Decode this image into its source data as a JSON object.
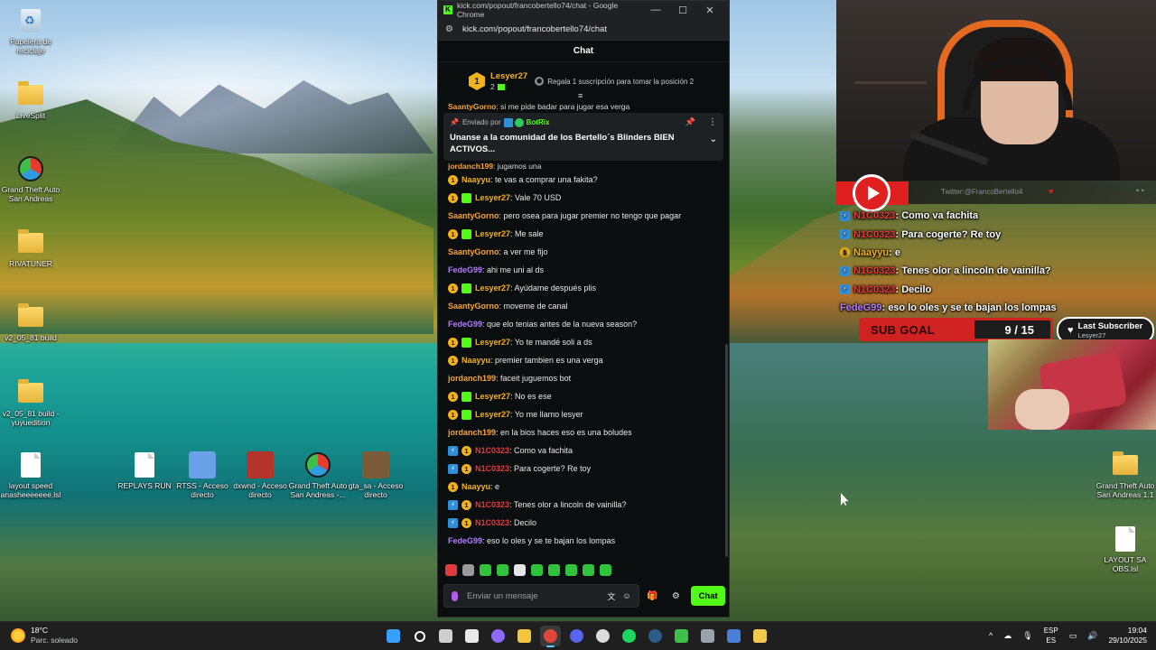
{
  "desktop": {
    "icons_left": [
      {
        "label": "Papelera de reciclaje",
        "kind": "bin"
      },
      {
        "label": "LiveSplit",
        "kind": "folder"
      },
      {
        "label": "Grand Theft Auto San Andreas",
        "kind": "gta"
      },
      {
        "label": "RIVATUNER",
        "kind": "folder"
      },
      {
        "label": "v2_05_81 build",
        "kind": "folder"
      },
      {
        "label": "v2_05_81 build - yuyuedition",
        "kind": "folder"
      },
      {
        "label": "layout speed anasheeeeeee.lsl",
        "kind": "file"
      }
    ],
    "icons_bottom": [
      {
        "label": "REPLAYS RUN",
        "kind": "file"
      },
      {
        "label": "RTSS - Acceso directo",
        "kind": "shortcut"
      },
      {
        "label": "dxwnd - Acceso directo",
        "kind": "shortcut"
      },
      {
        "label": "Grand Theft Auto San Andreas -...",
        "kind": "gta"
      },
      {
        "label": "gta_sa - Acceso directo",
        "kind": "shortcut"
      }
    ],
    "icons_right": [
      {
        "label": "Grand Theft Auto San Andreas 1.1",
        "kind": "folder"
      },
      {
        "label": "LAYOUT SA OBS.lsl",
        "kind": "file"
      }
    ]
  },
  "browser": {
    "title": "kick.com/popout/francobertello74/chat - Google Chrome",
    "url": "kick.com/popout/francobertello74/chat",
    "controls": {
      "minimize": "—",
      "maximize": "☐",
      "close": "✕"
    }
  },
  "chat": {
    "header": "Chat",
    "leaderboard": {
      "rank": "1",
      "name": "Lesyer27",
      "count": "2",
      "gift_message": "Regala 1 suscripción para tomar la posición 2"
    },
    "partial_line": {
      "user": "SaantyGorno",
      "text": ": si me pide badar para jugar esa verga"
    },
    "pinned": {
      "sent_by": "Enviado por",
      "bot_name": "BotRix",
      "text": "Unanse a la comunidad de los Bertello´s Blinders BIEN ACTIVOS..."
    },
    "partial_line2": {
      "user": "jordanch199",
      "text": ": jugamos una"
    },
    "messages": [
      {
        "badges": [
          "og"
        ],
        "user": "Naayyu",
        "color": "#f2b21d",
        "text": ": te vas a comprar una fakita?"
      },
      {
        "badges": [
          "og",
          "gift"
        ],
        "user": "Lesyer27",
        "color": "#f2b21d",
        "text": ": Vale 70 USD"
      },
      {
        "badges": [],
        "user": "SaantyGorno",
        "color": "#f7a33a",
        "text": ": pero osea para jugar premier no tengo que pagar"
      },
      {
        "badges": [
          "og",
          "gift"
        ],
        "user": "Lesyer27",
        "color": "#f2b21d",
        "text": ": Me sale"
      },
      {
        "badges": [],
        "user": "SaantyGorno",
        "color": "#f7a33a",
        "text": ": a ver me fijo"
      },
      {
        "badges": [],
        "user": "FedeG99",
        "color": "#b57cff",
        "text": ": ahi me uni al ds"
      },
      {
        "badges": [
          "og",
          "gift"
        ],
        "user": "Lesyer27",
        "color": "#f2b21d",
        "text": ": Ayúdame después plis"
      },
      {
        "badges": [],
        "user": "SaantyGorno",
        "color": "#f7a33a",
        "text": ": moveme de canal"
      },
      {
        "badges": [],
        "user": "FedeG99",
        "color": "#b57cff",
        "text": ": que elo tenias antes de la nueva season?"
      },
      {
        "badges": [
          "og",
          "gift"
        ],
        "user": "Lesyer27",
        "color": "#f2b21d",
        "text": ": Yo te mandé soli a ds"
      },
      {
        "badges": [
          "og"
        ],
        "user": "Naayyu",
        "color": "#f2b21d",
        "text": ": premier tambien es una verga"
      },
      {
        "badges": [],
        "user": "jordanch199",
        "color": "#f7a33a",
        "text": ": faceit juguemos bot"
      },
      {
        "badges": [
          "og",
          "gift"
        ],
        "user": "Lesyer27",
        "color": "#f2b21d",
        "text": ": No es ese"
      },
      {
        "badges": [
          "og",
          "gift"
        ],
        "user": "Lesyer27",
        "color": "#f2b21d",
        "text": ": Yo me llamo lesyer"
      },
      {
        "badges": [],
        "user": "jordanch199",
        "color": "#f7a33a",
        "text": ": en la bios haces eso es una boludes"
      },
      {
        "badges": [
          "bot",
          "og"
        ],
        "user": "N1C0323",
        "color": "#e8383d",
        "text": ": Como va fachita"
      },
      {
        "badges": [
          "bot",
          "og"
        ],
        "user": "N1C0323",
        "color": "#e8383d",
        "text": ": Para cogerte? Re toy"
      },
      {
        "badges": [
          "og"
        ],
        "user": "Naayyu",
        "color": "#f2b21d",
        "text": ": e"
      },
      {
        "badges": [
          "bot",
          "og"
        ],
        "user": "N1C0323",
        "color": "#e8383d",
        "text": ": Tenes olor a lincoln de vainilla?"
      },
      {
        "badges": [
          "bot",
          "og"
        ],
        "user": "N1C0323",
        "color": "#e8383d",
        "text": ": Decilo"
      },
      {
        "badges": [],
        "user": "FedeG99",
        "color": "#b57cff",
        "text": ": eso lo oles y se te bajan los lompas"
      }
    ],
    "emote_colors": [
      "#e23b3b",
      "#9a9a9a",
      "#2fc43b",
      "#2fc43b",
      "#e6e6e6",
      "#2fc43b",
      "#2fc43b",
      "#2fc43b",
      "#2fc43b",
      "#2fc43b"
    ],
    "input_placeholder": "Enviar un mensaje",
    "send_label": "Chat"
  },
  "overlay": {
    "twitter": "Twitter:@FrancoBertello4",
    "chat": [
      {
        "badges": [
          "bot"
        ],
        "user": "N1C0323",
        "color": "#e8383d",
        "text": ": Como va fachita"
      },
      {
        "badges": [
          "bot"
        ],
        "user": "N1C0323",
        "color": "#e8383d",
        "text": ": Para cogerte? Re toy"
      },
      {
        "badges": [
          "og"
        ],
        "user": "Naayyu",
        "color": "#f2b21d",
        "text": " : e"
      },
      {
        "badges": [
          "bot"
        ],
        "user": "N1C0323",
        "color": "#e8383d",
        "text": ": Tenes olor a lincoln de vainilla?"
      },
      {
        "badges": [
          "bot"
        ],
        "user": "N1C0323",
        "color": "#e8383d",
        "text": ": Decilo"
      },
      {
        "badges": [],
        "user": "FedeG99",
        "color": "#b57cff",
        "text": ": eso lo oles y se te bajan los lompas"
      }
    ],
    "sub_goal": {
      "label": "SUB GOAL",
      "current": 9,
      "target": 15,
      "display": "9 / 15"
    },
    "last_subscriber": {
      "title": "Last Subscriber",
      "name": "Lesyer27"
    }
  },
  "taskbar": {
    "weather": {
      "temp": "18°C",
      "status": "Parc. soleado"
    },
    "apps": [
      {
        "name": "windows-start",
        "color": "#3aa0ff"
      },
      {
        "name": "search",
        "color": "#ffffff"
      },
      {
        "name": "task-view",
        "color": "#cfcfcf"
      },
      {
        "name": "store",
        "color": "#e8e8e8"
      },
      {
        "name": "cortana",
        "color": "#8b6cff"
      },
      {
        "name": "file-explorer",
        "color": "#f4c43d"
      },
      {
        "name": "chrome",
        "color": "#e0463a",
        "active": true
      },
      {
        "name": "discord",
        "color": "#5865f2"
      },
      {
        "name": "obs",
        "color": "#dcdcdc"
      },
      {
        "name": "spotify",
        "color": "#1ed760"
      },
      {
        "name": "steam",
        "color": "#2b5d88"
      },
      {
        "name": "gta",
        "color": "#3cc04a"
      },
      {
        "name": "app-gray",
        "color": "#9aa2aa"
      },
      {
        "name": "monitor",
        "color": "#4a7fd8"
      },
      {
        "name": "kick",
        "color": "#f2c94c"
      }
    ],
    "lang": {
      "top": "ESP",
      "bottom": "ES"
    },
    "time": "19:04",
    "date": "29/10/2025"
  }
}
